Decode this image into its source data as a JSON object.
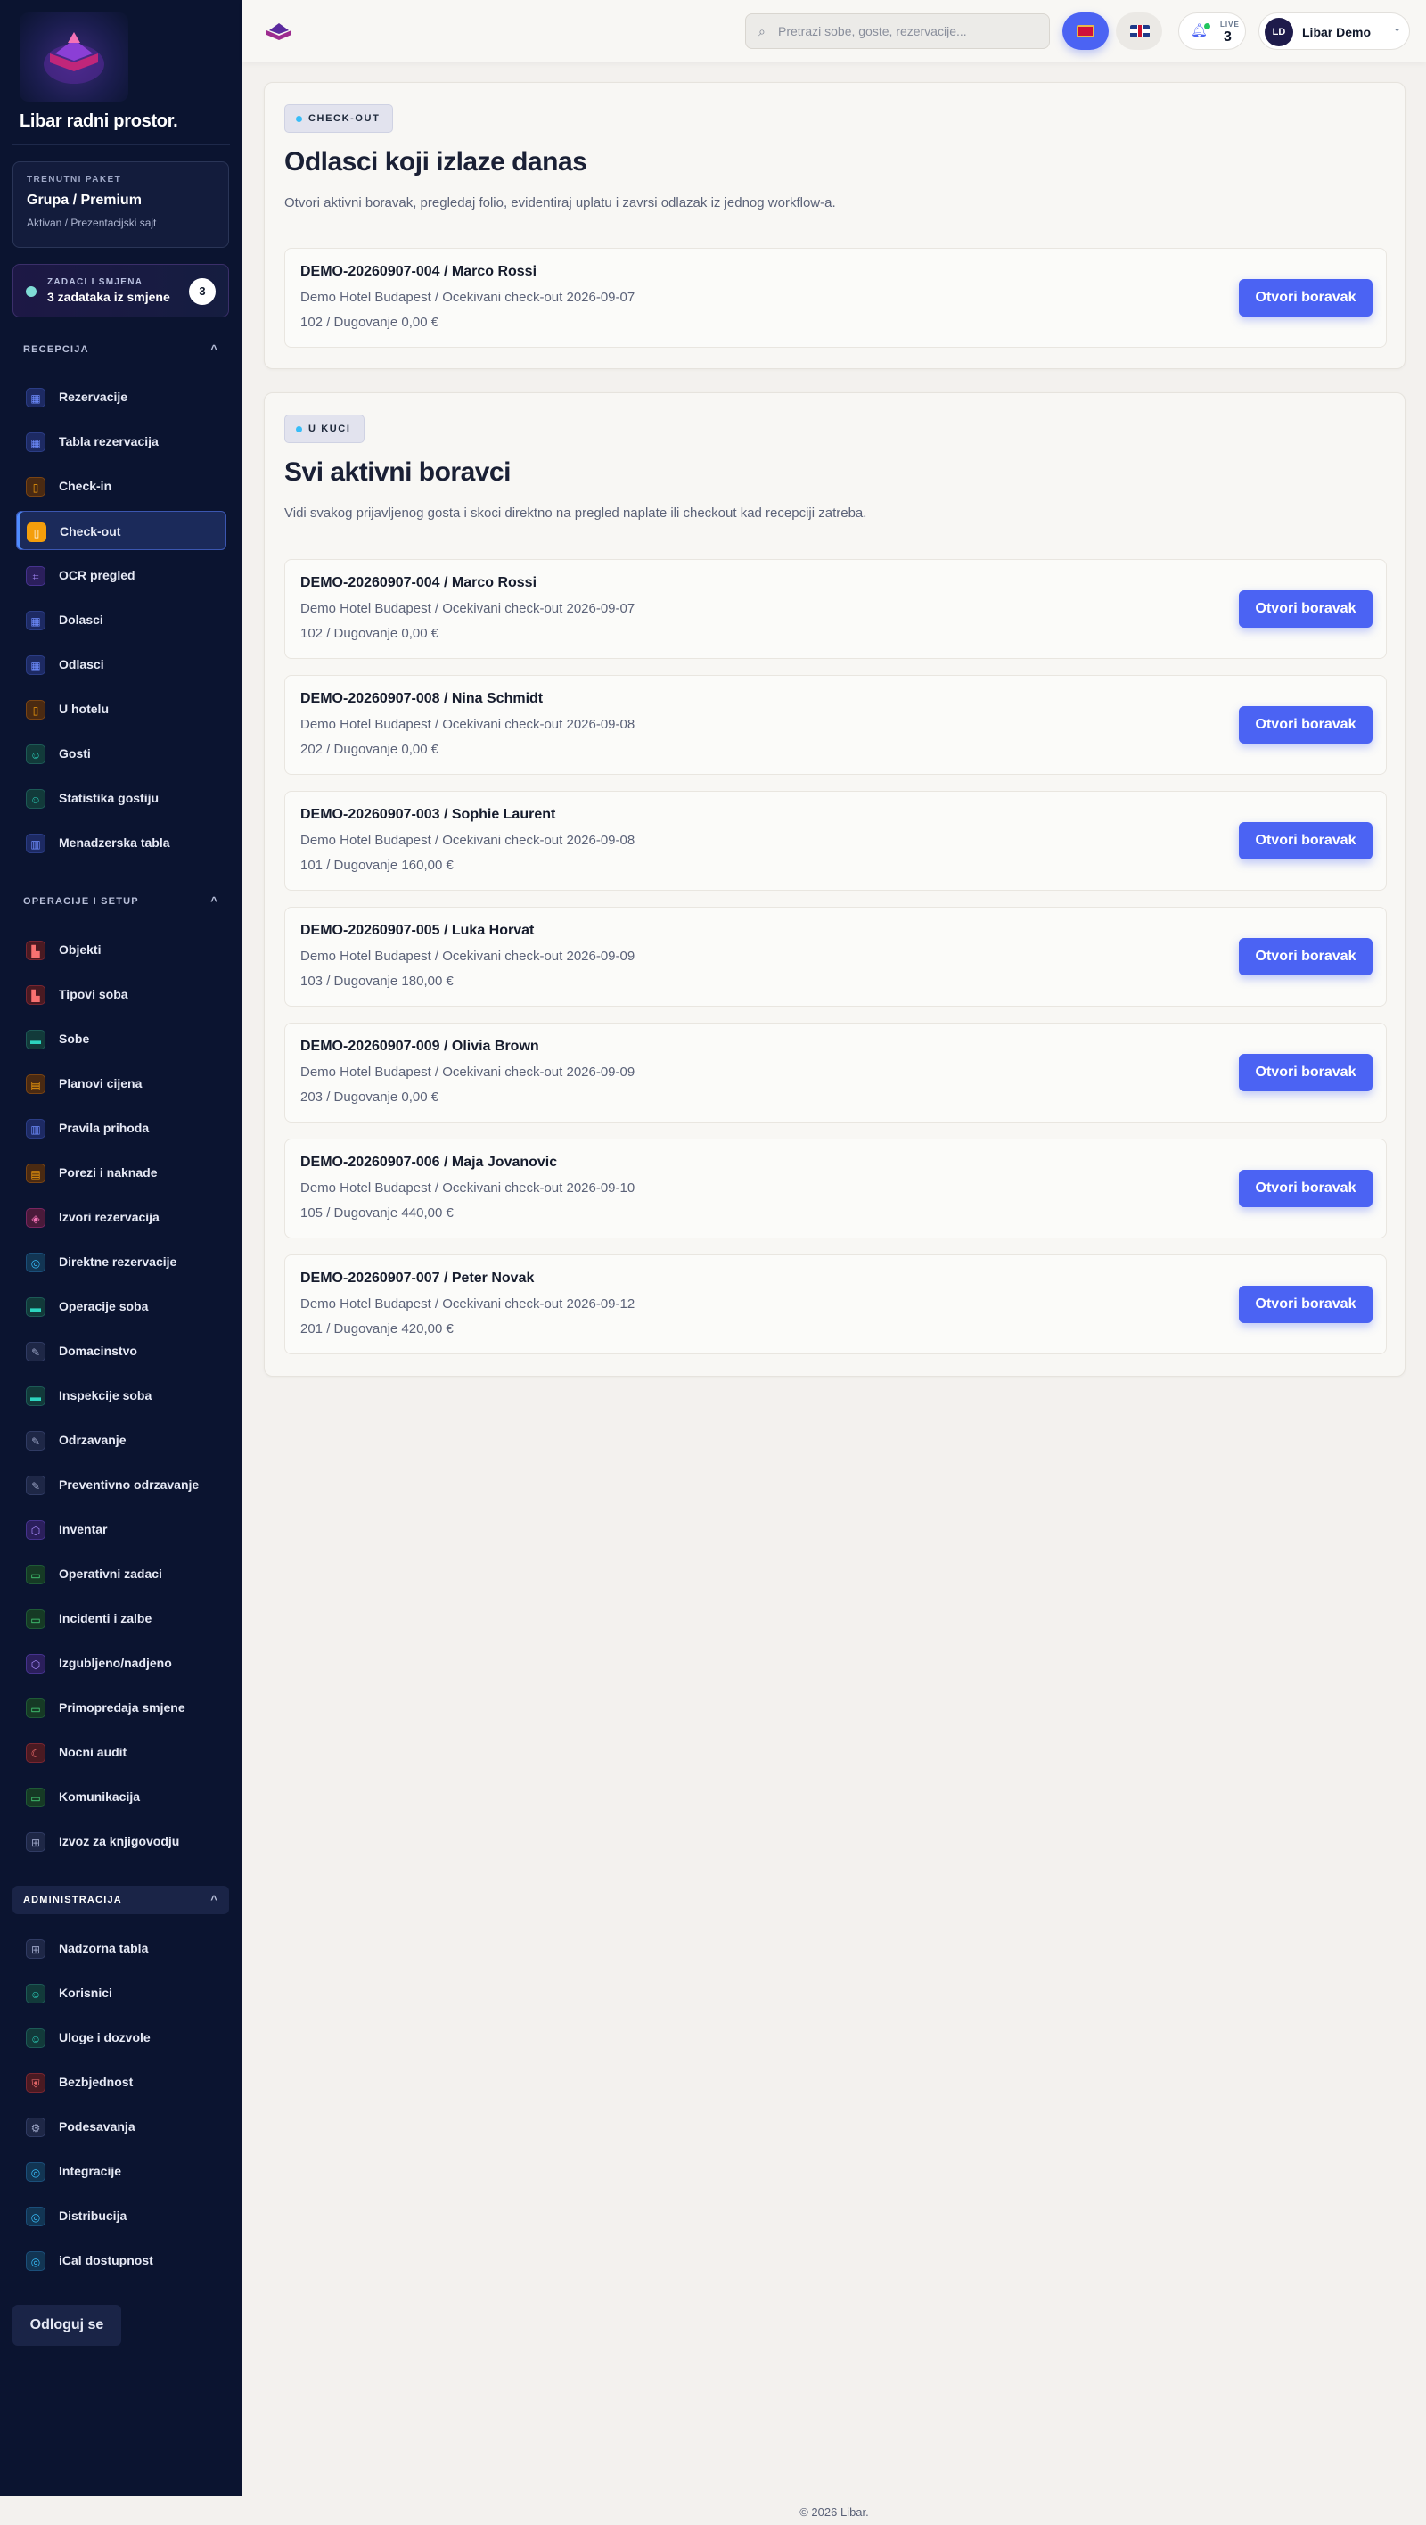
{
  "sidebar": {
    "brand": "Libar radni prostor.",
    "package": {
      "label": "TRENUTNI PAKET",
      "value": "Grupa / Premium",
      "status": "Aktivan / Prezentacijski sajt"
    },
    "tasks": {
      "label": "ZADACI I SMJENA",
      "value": "3 zadataka iz smjene",
      "count": "3"
    },
    "sections": [
      {
        "title": "RECEPCIJA",
        "caret": "^"
      },
      {
        "title": "OPERACIJE I SETUP",
        "caret": "^"
      },
      {
        "title": "ADMINISTRACIJA",
        "caret": "^"
      }
    ],
    "reception_items": [
      {
        "label": "Rezervacije",
        "icon": "calendar-icon"
      },
      {
        "label": "Tabla rezervacija",
        "icon": "calendar-icon"
      },
      {
        "label": "Check-in",
        "icon": "door-icon"
      },
      {
        "label": "Check-out",
        "icon": "door-icon",
        "active": true
      },
      {
        "label": "OCR pregled",
        "icon": "scan-icon"
      },
      {
        "label": "Dolasci",
        "icon": "calendar-icon"
      },
      {
        "label": "Odlasci",
        "icon": "calendar-icon"
      },
      {
        "label": "U hotelu",
        "icon": "door-icon"
      },
      {
        "label": "Gosti",
        "icon": "user-icon"
      },
      {
        "label": "Statistika gostiju",
        "icon": "user-icon"
      },
      {
        "label": "Menadzerska tabla",
        "icon": "bar-chart-icon"
      }
    ],
    "operations_items": [
      {
        "label": "Objekti",
        "icon": "building-icon"
      },
      {
        "label": "Tipovi soba",
        "icon": "building-icon"
      },
      {
        "label": "Sobe",
        "icon": "bed-icon"
      },
      {
        "label": "Planovi cijena",
        "icon": "document-icon"
      },
      {
        "label": "Pravila prihoda",
        "icon": "bar-chart-icon"
      },
      {
        "label": "Porezi i naknade",
        "icon": "document-icon"
      },
      {
        "label": "Izvori rezervacija",
        "icon": "tag-icon"
      },
      {
        "label": "Direktne rezervacije",
        "icon": "globe-icon"
      },
      {
        "label": "Operacije soba",
        "icon": "bed-icon"
      },
      {
        "label": "Domacinstvo",
        "icon": "brush-icon"
      },
      {
        "label": "Inspekcije soba",
        "icon": "bed-icon"
      },
      {
        "label": "Odrzavanje",
        "icon": "wrench-icon"
      },
      {
        "label": "Preventivno odrzavanje",
        "icon": "wrench-icon"
      },
      {
        "label": "Inventar",
        "icon": "box-icon"
      },
      {
        "label": "Operativni zadaci",
        "icon": "chat-icon"
      },
      {
        "label": "Incidenti i zalbe",
        "icon": "chat-icon"
      },
      {
        "label": "Izgubljeno/nadjeno",
        "icon": "box-icon"
      },
      {
        "label": "Primopredaja smjene",
        "icon": "chat-icon"
      },
      {
        "label": "Nocni audit",
        "icon": "moon-icon"
      },
      {
        "label": "Komunikacija",
        "icon": "chat-icon"
      },
      {
        "label": "Izvoz za knjigovodju",
        "icon": "grid-icon"
      }
    ],
    "admin_items": [
      {
        "label": "Nadzorna tabla",
        "icon": "grid-icon"
      },
      {
        "label": "Korisnici",
        "icon": "user-icon"
      },
      {
        "label": "Uloge i dozvole",
        "icon": "user-icon"
      },
      {
        "label": "Bezbjednost",
        "icon": "shield-icon"
      },
      {
        "label": "Podesavanja",
        "icon": "gear-icon"
      },
      {
        "label": "Integracije",
        "icon": "globe-icon"
      },
      {
        "label": "Distribucija",
        "icon": "globe-icon"
      },
      {
        "label": "iCal dostupnost",
        "icon": "globe-icon"
      }
    ],
    "logout": "Odloguj se"
  },
  "header": {
    "search_placeholder": "Pretrazi sobe, goste, rezervacije...",
    "live_label": "LIVE",
    "live_count": "3",
    "user_initials": "LD",
    "user_name": "Libar Demo"
  },
  "checkout": {
    "tag": "CHECK-OUT",
    "title": "Odlasci koji izlaze danas",
    "description": "Otvori aktivni boravak, pregledaj folio, evidentiraj uplatu i zavrsi odlazak iz jednog workflow-a.",
    "rows": [
      {
        "title": "DEMO-20260907-004 / Marco Rossi",
        "line1": "Demo Hotel Budapest / Ocekivani check-out 2026-09-07",
        "line2": "102 / Dugovanje 0,00 €",
        "button": "Otvori boravak"
      }
    ]
  },
  "in_house": {
    "tag": "U KUCI",
    "title": "Svi aktivni boravci",
    "description": "Vidi svakog prijavljenog gosta i skoci direktno na pregled naplate ili checkout kad recepciji zatreba.",
    "rows": [
      {
        "title": "DEMO-20260907-004 / Marco Rossi",
        "line1": "Demo Hotel Budapest / Ocekivani check-out 2026-09-07",
        "line2": "102 / Dugovanje 0,00 €",
        "button": "Otvori boravak"
      },
      {
        "title": "DEMO-20260907-008 / Nina Schmidt",
        "line1": "Demo Hotel Budapest / Ocekivani check-out 2026-09-08",
        "line2": "202 / Dugovanje 0,00 €",
        "button": "Otvori boravak"
      },
      {
        "title": "DEMO-20260907-003 / Sophie Laurent",
        "line1": "Demo Hotel Budapest / Ocekivani check-out 2026-09-08",
        "line2": "101 / Dugovanje 160,00 €",
        "button": "Otvori boravak"
      },
      {
        "title": "DEMO-20260907-005 / Luka Horvat",
        "line1": "Demo Hotel Budapest / Ocekivani check-out 2026-09-09",
        "line2": "103 / Dugovanje 180,00 €",
        "button": "Otvori boravak"
      },
      {
        "title": "DEMO-20260907-009 / Olivia Brown",
        "line1": "Demo Hotel Budapest / Ocekivani check-out 2026-09-09",
        "line2": "203 / Dugovanje 0,00 €",
        "button": "Otvori boravak"
      },
      {
        "title": "DEMO-20260907-006 / Maja Jovanovic",
        "line1": "Demo Hotel Budapest / Ocekivani check-out 2026-09-10",
        "line2": "105 / Dugovanje 440,00 €",
        "button": "Otvori boravak"
      },
      {
        "title": "DEMO-20260907-007 / Peter Novak",
        "line1": "Demo Hotel Budapest / Ocekivani check-out 2026-09-12",
        "line2": "201 / Dugovanje 420,00 €",
        "button": "Otvori boravak"
      }
    ]
  },
  "footer": "© 2026 Libar.",
  "colors": {
    "accent": "#4b63f3",
    "sidebar_bg": "#0b1430",
    "page_bg": "#f3f1ee"
  }
}
